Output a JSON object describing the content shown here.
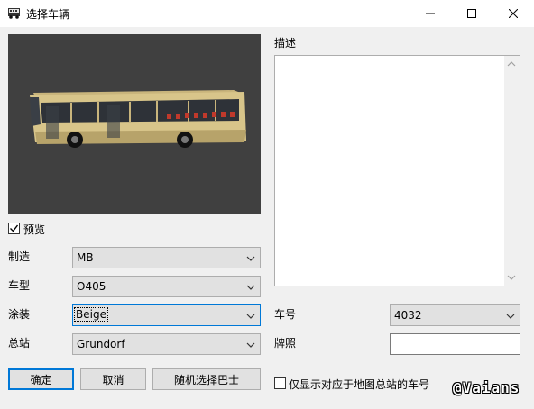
{
  "window": {
    "title": "选择车辆",
    "icons": {
      "app": "bus-app-icon",
      "minimize": "minimize-icon",
      "maximize": "maximize-icon",
      "close": "close-icon"
    }
  },
  "preview": {
    "image": "bus-3d-preview",
    "checkbox_label": "预览",
    "checked": true
  },
  "fields": {
    "manufacturer": {
      "label": "制造",
      "value": "MB"
    },
    "model": {
      "label": "车型",
      "value": "O405"
    },
    "livery": {
      "label": "涂装",
      "value": "Beige"
    },
    "depot": {
      "label": "总站",
      "value": "Grundorf"
    }
  },
  "description": {
    "label": "描述",
    "text": ""
  },
  "vehicle_number": {
    "label": "车号",
    "value": "4032"
  },
  "license_plate": {
    "label": "牌照",
    "value": ""
  },
  "buttons": {
    "ok": "确定",
    "cancel": "取消",
    "random_bus": "随机选择巴士"
  },
  "filter_checkbox": {
    "label": "仅显示对应于地图总站的车号",
    "checked": false
  },
  "watermark": "@Vaians",
  "colors": {
    "accent": "#0078d7",
    "window_bg": "#f0f0f0",
    "preview_bg": "#404040",
    "bus_body": "#d8c58a"
  }
}
